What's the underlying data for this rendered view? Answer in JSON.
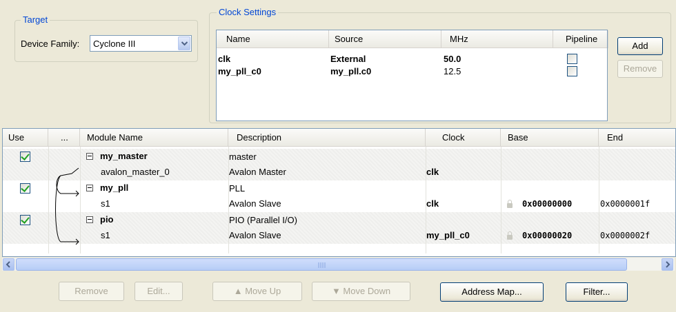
{
  "target": {
    "title": "Target",
    "device_family_label": "Device Family:",
    "device_family_value": "Cyclone III"
  },
  "clock_settings": {
    "title": "Clock Settings",
    "columns": [
      "Name",
      "Source",
      "MHz",
      "Pipeline"
    ],
    "rows": [
      {
        "name": "clk",
        "source": "External",
        "mhz": "50.0",
        "pipeline": false
      },
      {
        "name": "my_pll_c0",
        "source": "my_pll.c0",
        "mhz": "12.5",
        "pipeline": false
      }
    ],
    "add_label": "Add",
    "remove_label": "Remove"
  },
  "modules": {
    "columns": [
      "Use",
      "...",
      "Module Name",
      "Description",
      "Clock",
      "Base",
      "End"
    ],
    "rows": [
      {
        "use": true,
        "name": "my_master",
        "description": "master",
        "clock": "",
        "base": "",
        "end": ""
      },
      {
        "name": "avalon_master_0",
        "description": "Avalon Master",
        "clock": "clk",
        "base": "",
        "end": ""
      },
      {
        "use": true,
        "name": "my_pll",
        "description": "PLL",
        "clock": "",
        "base": "",
        "end": ""
      },
      {
        "name": "s1",
        "description": "Avalon Slave",
        "clock": "clk",
        "base": "0x00000000",
        "end": "0x0000001f"
      },
      {
        "use": true,
        "name": "pio",
        "description": "PIO (Parallel I/O)",
        "clock": "",
        "base": "",
        "end": ""
      },
      {
        "name": "s1",
        "description": "Avalon Slave",
        "clock": "my_pll_c0",
        "base": "0x00000020",
        "end": "0x0000002f"
      }
    ]
  },
  "buttons": {
    "remove": "Remove",
    "edit": "Edit...",
    "move_up": "Move Up",
    "move_down": "Move Down",
    "address_map": "Address Map...",
    "filter": "Filter..."
  },
  "colors": {
    "group_title": "#0046d5",
    "window_bg": "#ece9d8",
    "checkbox_check": "#21a121",
    "scroll_blue": "#b7cdf6"
  }
}
